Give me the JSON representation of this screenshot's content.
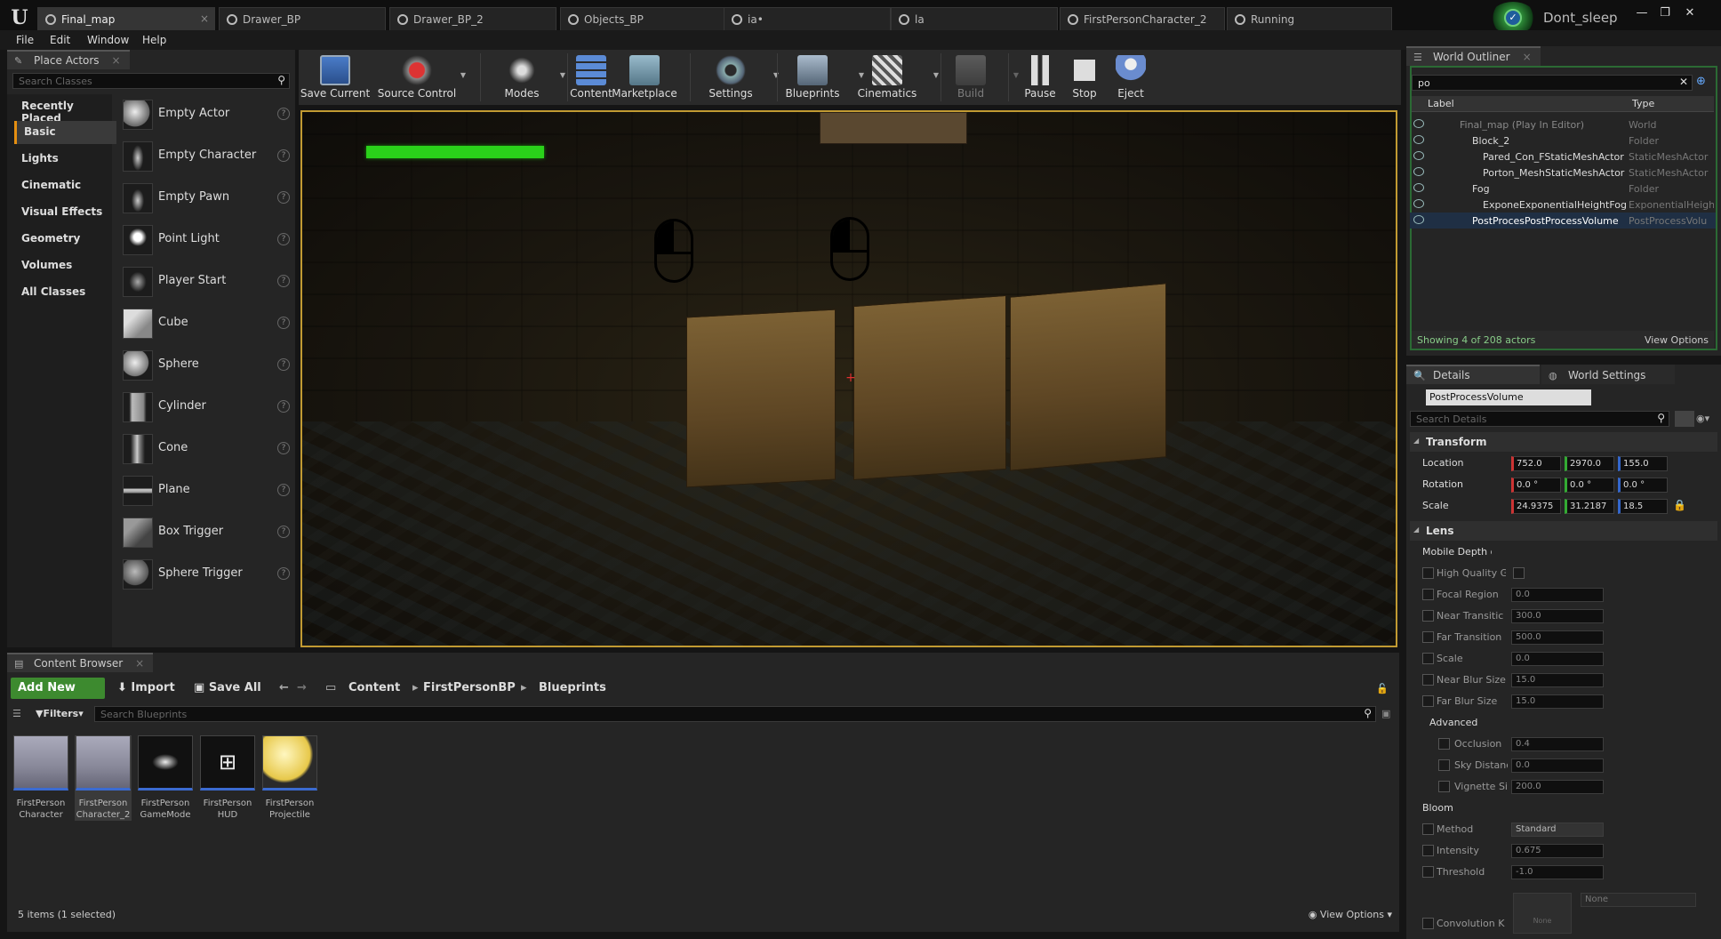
{
  "tabs": [
    {
      "label": "Final_map",
      "active": true
    },
    {
      "label": "Drawer_BP"
    },
    {
      "label": "Drawer_BP_2"
    },
    {
      "label": "Objects_BP"
    },
    {
      "label": "ia•"
    },
    {
      "label": "la"
    },
    {
      "label": "FirstPersonCharacter_2"
    },
    {
      "label": "Running"
    }
  ],
  "user": {
    "name": "Dont_sleep"
  },
  "menu": [
    "File",
    "Edit",
    "Window",
    "Help"
  ],
  "place_actors": {
    "title": "Place Actors",
    "search_placeholder": "Search Classes",
    "categories": [
      "Recently Placed",
      "Basic",
      "Lights",
      "Cinematic",
      "Visual Effects",
      "Geometry",
      "Volumes",
      "All Classes"
    ],
    "active_category": "Basic",
    "actors": [
      "Empty Actor",
      "Empty Character",
      "Empty Pawn",
      "Point Light",
      "Player Start",
      "Cube",
      "Sphere",
      "Cylinder",
      "Cone",
      "Plane",
      "Box Trigger",
      "Sphere Trigger"
    ]
  },
  "toolbar": {
    "save_current": "Save Current",
    "source_control": "Source Control",
    "modes": "Modes",
    "content": "Content",
    "marketplace": "Marketplace",
    "settings": "Settings",
    "blueprints": "Blueprints",
    "cinematics": "Cinematics",
    "build": "Build",
    "pause": "Pause",
    "stop": "Stop",
    "eject": "Eject"
  },
  "viewport": {
    "health_fill": 1.0
  },
  "outliner": {
    "title": "World Outliner",
    "search_value": "po",
    "col_label": "Label",
    "col_type": "Type",
    "rows": [
      {
        "name": "Final_map (Play In Editor)",
        "type": "World"
      },
      {
        "name": "Block_2",
        "type": "Folder"
      },
      {
        "name": "Pared_Con_FStaticMeshActor",
        "type": "StaticMeshActor"
      },
      {
        "name": "Porton_MeshStaticMeshActor",
        "type": "StaticMeshActor"
      },
      {
        "name": "Fog",
        "type": "Folder"
      },
      {
        "name": "ExponeExponentialHeightFog",
        "type": "ExponentialHeigh"
      },
      {
        "name": "PostProcesPostProcessVolume",
        "type": "PostProcessVolu"
      }
    ],
    "status": "Showing 4 of 208 actors",
    "view_options": "View Options"
  },
  "details": {
    "tab_details": "Details",
    "tab_world_settings": "World Settings",
    "object_name": "PostProcessVolume",
    "search_placeholder": "Search Details",
    "transform": {
      "title": "Transform",
      "location_label": "Location",
      "location": [
        "752.0",
        "2970.0",
        "155.0"
      ],
      "rotation_label": "Rotation",
      "rotation": [
        "0.0 °",
        "0.0 °",
        "0.0 °"
      ],
      "scale_label": "Scale",
      "scale": [
        "24.9375",
        "31.2187",
        "18.5"
      ]
    },
    "lens": {
      "title": "Lens",
      "mobile_dof": "Mobile Depth of Fie",
      "high_quality": "High Quality G",
      "focal_region": "Focal Region",
      "focal_region_val": "0.0",
      "near_transition": "Near Transitic",
      "near_transition_val": "300.0",
      "far_transition": "Far Transition",
      "far_transition_val": "500.0",
      "scale": "Scale",
      "scale_val": "0.0",
      "near_blur": "Near Blur Size",
      "near_blur_val": "15.0",
      "far_blur": "Far Blur Size",
      "far_blur_val": "15.0",
      "advanced": "Advanced",
      "occlusion": "Occlusion",
      "occlusion_val": "0.4",
      "sky_distance": "Sky Distanc",
      "sky_distance_val": "0.0",
      "vignette": "Vignette Siz",
      "vignette_val": "200.0"
    },
    "bloom": {
      "title": "Bloom",
      "method": "Method",
      "method_val": "Standard",
      "intensity": "Intensity",
      "intensity_val": "0.675",
      "threshold": "Threshold",
      "threshold_val": "-1.0",
      "convolution": "Convolution K",
      "none_label": "None",
      "none_select": "None"
    }
  },
  "content_browser": {
    "title": "Content Browser",
    "add_new": "Add New",
    "import": "Import",
    "save_all": "Save All",
    "path": [
      "Content",
      "FirstPersonBP",
      "Blueprints"
    ],
    "filters": "Filters",
    "search_placeholder": "Search Blueprints",
    "assets": [
      {
        "line1": "FirstPerson",
        "line2": "Character"
      },
      {
        "line1": "FirstPerson",
        "line2": "Character_2",
        "selected": true
      },
      {
        "line1": "FirstPerson",
        "line2": "GameMode"
      },
      {
        "line1": "FirstPerson",
        "line2": "HUD"
      },
      {
        "line1": "FirstPerson",
        "line2": "Projectile"
      }
    ],
    "status": "5 items (1 selected)",
    "view_options": "View Options"
  }
}
